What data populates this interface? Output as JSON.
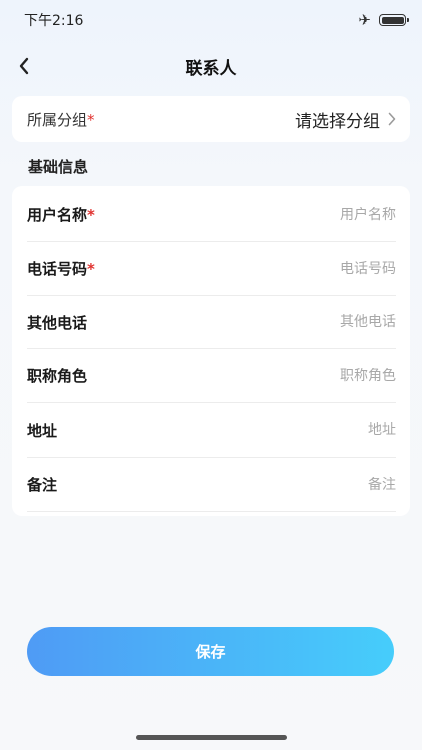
{
  "status_bar": {
    "time": "下午2:16",
    "icons": [
      "airplane-mode-icon",
      "battery-icon"
    ]
  },
  "header": {
    "title": "联系人",
    "back_icon": "chevron-left-icon"
  },
  "group": {
    "label": "所属分组",
    "required_mark": "*",
    "placeholder": "请选择分组",
    "arrow_icon": "chevron-right-icon"
  },
  "section": {
    "title": "基础信息"
  },
  "fields": [
    {
      "label": "用户名称",
      "required": true,
      "value": "",
      "placeholder": "用户名称"
    },
    {
      "label": "电话号码",
      "required": true,
      "value": "",
      "placeholder": "电话号码"
    },
    {
      "label": "其他电话",
      "required": false,
      "value": "",
      "placeholder": "其他电话"
    },
    {
      "label": "职称角色",
      "required": false,
      "value": "",
      "placeholder": "职称角色"
    },
    {
      "label": "地址",
      "required": false,
      "value": "",
      "placeholder": "地址"
    },
    {
      "label": "备注",
      "required": false,
      "value": "",
      "placeholder": "备注"
    }
  ],
  "actions": {
    "save_label": "保存"
  },
  "colors": {
    "accent_start": "#4f9bf5",
    "accent_end": "#46cdfb",
    "required": "#e0322f",
    "placeholder": "#a8a8a8"
  }
}
